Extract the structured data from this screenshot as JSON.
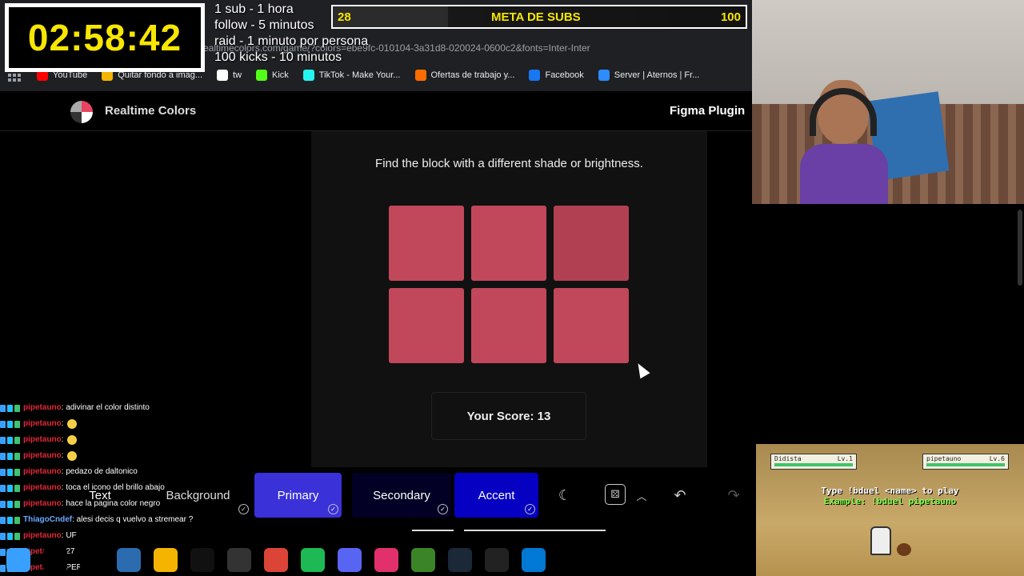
{
  "overlay": {
    "timer": "02:58:42",
    "rules": [
      "1 sub - 1 hora",
      "follow - 5 minutos",
      "raid - 1 minuto por persona",
      "100 kicks - 10 minutos"
    ],
    "goal": {
      "current": "28",
      "label": "META DE SUBS",
      "target": "100",
      "progress_fraction": 0.28
    }
  },
  "browser": {
    "url": "realtimecolors.com/game/?colors=ebe9fc-010104-3a31d8-020024-0600c2&fonts=Inter-Inter",
    "bookmarks": [
      {
        "label": "YouTube",
        "color": "#ff0000"
      },
      {
        "label": "Quitar fondo a imag...",
        "color": "#f4b400"
      },
      {
        "label": "tw",
        "color": "#ffffff"
      },
      {
        "label": "Kick",
        "color": "#53fc18"
      },
      {
        "label": "TikTok - Make Your...",
        "color": "#25f4ee"
      },
      {
        "label": "Ofertas de trabajo y...",
        "color": "#ff6d00"
      },
      {
        "label": "Facebook",
        "color": "#1877f2"
      },
      {
        "label": "Server | Aternos | Fr...",
        "color": "#2d8cff"
      }
    ]
  },
  "page": {
    "brand": "Realtime Colors",
    "figma": "Figma Plugin",
    "prompt": "Find the block with a different shade or brightness.",
    "score": "Your Score: 13",
    "cells": [
      "#c1475b",
      "#c1475b",
      "#b14052",
      "#c1475b",
      "#c1475b",
      "#c1475b"
    ]
  },
  "toolbar": {
    "text_label": "Text",
    "background_label": "Background",
    "primary_label": "Primary",
    "secondary_label": "Secondary",
    "accent_label": "Accent",
    "primary_color": "#3a31d8",
    "secondary_color": "#020024",
    "accent_color": "#0600c2"
  },
  "chat": [
    {
      "user": "pipetauno",
      "msg": ": adivinar el color distinto"
    },
    {
      "user": "pipetauno",
      "msg": ":",
      "emoji": true
    },
    {
      "user": "pipetauno",
      "msg": ":",
      "emoji": true
    },
    {
      "user": "pipetauno",
      "msg": ":",
      "emoji": true
    },
    {
      "user": "pipetauno",
      "msg": ": pedazo de daltonico"
    },
    {
      "user": "pipetauno",
      "msg": ": toca el icono del brillo abajo"
    },
    {
      "user": "pipetauno",
      "msg": ": hace la pagina color negro"
    },
    {
      "user": "ThiagoCndef",
      "msg": ": alesi decis q vuelvo a stremear ?",
      "alt": true
    },
    {
      "user": "pipetauno",
      "msg": ": UF"
    },
    {
      "user": "pipetauno",
      "msg": ": 27"
    },
    {
      "user": "pipetauno",
      "msg": ": PERRO"
    }
  ],
  "duel": {
    "left_name": "Didista",
    "left_lv": "Lv.1",
    "right_name": "pipetauno",
    "right_lv": "Lv.6",
    "line1": "Type !bduel <name> to play",
    "line2": "Example: !bduel pipetauno"
  },
  "taskbar": {
    "apps": [
      {
        "name": "windows-start-icon",
        "color": "#3aa0ff"
      },
      {
        "name": "search-icon",
        "color": "#000"
      },
      {
        "name": "task-view-icon",
        "color": "#000"
      },
      {
        "name": "calculator-icon",
        "color": "#2b6cb0"
      },
      {
        "name": "file-explorer-icon",
        "color": "#f4b400"
      },
      {
        "name": "capcut-icon",
        "color": "#111"
      },
      {
        "name": "obs-icon",
        "color": "#333"
      },
      {
        "name": "chrome-icon",
        "color": "#db4437"
      },
      {
        "name": "spotify-icon",
        "color": "#1db954"
      },
      {
        "name": "discord-icon",
        "color": "#5865f2"
      },
      {
        "name": "instagram-icon",
        "color": "#e1306c"
      },
      {
        "name": "minecraft-icon",
        "color": "#3c8527"
      },
      {
        "name": "steam-icon",
        "color": "#1b2838"
      },
      {
        "name": "epic-games-icon",
        "color": "#222"
      },
      {
        "name": "edge-icon",
        "color": "#0078d4"
      }
    ]
  }
}
